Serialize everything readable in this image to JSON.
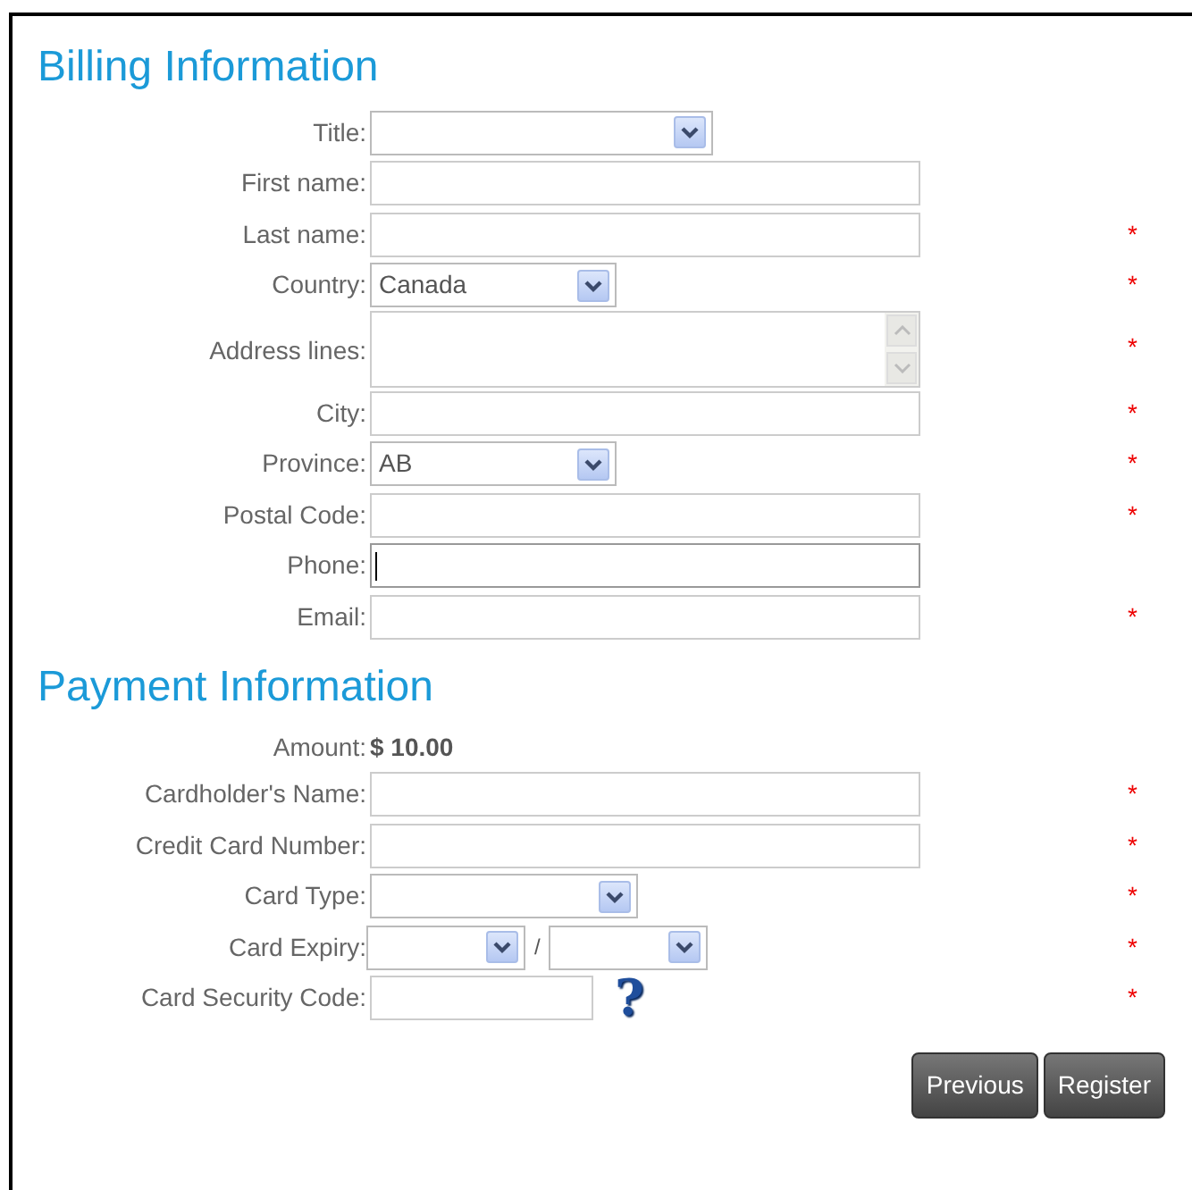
{
  "billing": {
    "heading": "Billing Information",
    "fields": [
      {
        "kind": "select",
        "label": "Title:",
        "required": false
      },
      {
        "kind": "text",
        "label": "First name:",
        "required": false,
        "focused": false
      },
      {
        "kind": "text",
        "label": "Last name:",
        "required": true,
        "focused": false
      },
      {
        "kind": "select",
        "label": "Country:",
        "value": "Canada",
        "required": true
      },
      {
        "kind": "textarea",
        "label": "Address lines:",
        "required": true
      },
      {
        "kind": "text",
        "label": "City:",
        "required": true,
        "focused": false
      },
      {
        "kind": "select",
        "label": "Province:",
        "value": "AB",
        "required": true
      },
      {
        "kind": "text",
        "label": "Postal Code:",
        "required": true,
        "focused": false
      },
      {
        "kind": "text",
        "label": "Phone:",
        "required": false,
        "focused": true
      },
      {
        "kind": "text",
        "label": "Email:",
        "required": true,
        "focused": false
      }
    ]
  },
  "payment": {
    "heading": "Payment Information",
    "fields": [
      {
        "kind": "amount",
        "label": "Amount:",
        "value": "$ 10.00",
        "required": false
      },
      {
        "kind": "text",
        "label": "Cardholder's Name:",
        "required": true,
        "focused": false
      },
      {
        "kind": "text",
        "label": "Credit Card Number:",
        "required": true,
        "focused": false
      },
      {
        "kind": "select",
        "label": "Card Type:",
        "required": true
      },
      {
        "kind": "expiry",
        "label": "Card Expiry:",
        "separator": "/",
        "required": true
      },
      {
        "kind": "security",
        "label": "Card Security Code:",
        "help_icon": "?",
        "required": true,
        "focused": false
      }
    ]
  },
  "required_mark": "*",
  "buttons": [
    "Previous",
    "Register"
  ]
}
